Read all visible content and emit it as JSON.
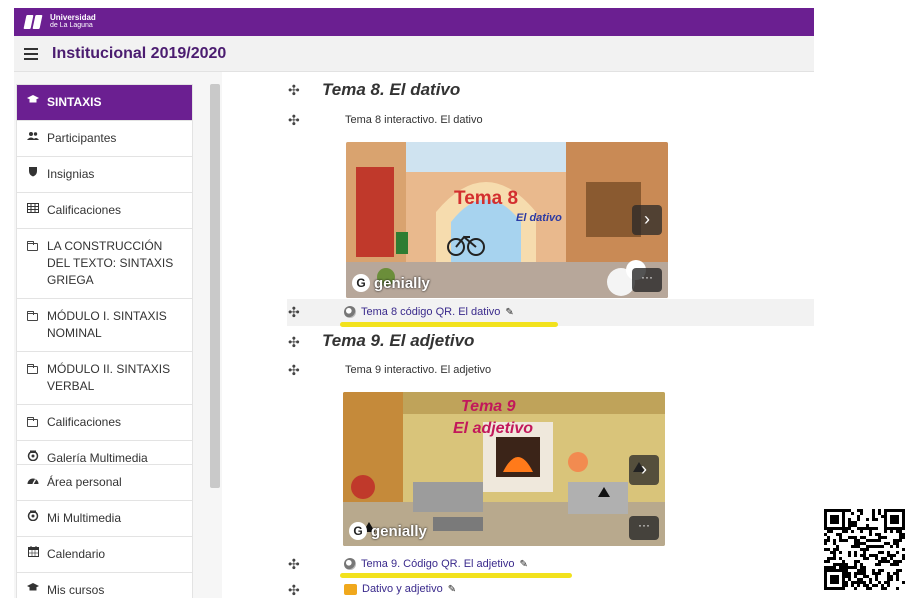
{
  "brand": {
    "line1": "Universidad",
    "line2": "de La Laguna"
  },
  "course": {
    "title": "Institucional 2019/2020"
  },
  "sidebar": {
    "course_items": [
      {
        "label": "SINTAXIS",
        "icon": "graduation-cap-icon",
        "active": true
      },
      {
        "label": "Participantes",
        "icon": "users-icon"
      },
      {
        "label": "Insignias",
        "icon": "shield-icon"
      },
      {
        "label": "Calificaciones",
        "icon": "table-icon"
      },
      {
        "label": "LA CONSTRUCCIÓN DEL TEXTO: SINTAXIS GRIEGA",
        "icon": "folder-icon"
      },
      {
        "label": "MÓDULO I. SINTAXIS NOMINAL",
        "icon": "folder-icon"
      },
      {
        "label": "MÓDULO II. SINTAXIS VERBAL",
        "icon": "folder-icon"
      },
      {
        "label": "Calificaciones",
        "icon": "folder-icon"
      },
      {
        "label": "Galería Multimedia",
        "icon": "media-icon"
      }
    ],
    "site_items": [
      {
        "label": "Área personal",
        "icon": "dashboard-icon"
      },
      {
        "label": "Mi Multimedia",
        "icon": "media-icon"
      },
      {
        "label": "Calendario",
        "icon": "calendar-icon"
      },
      {
        "label": "Mis cursos",
        "icon": "graduation-cap-icon"
      }
    ]
  },
  "content": {
    "section8": {
      "title": "Tema 8. El dativo",
      "activity": "Tema 8 interactivo. El dativo",
      "card_title": "Tema 8",
      "card_subtitle": "El dativo",
      "card_brand": "genially",
      "qr_link": "Tema 8 código QR. El dativo"
    },
    "section9": {
      "title": "Tema 9. El adjetivo",
      "activity": "Tema 9 interactivo. El adjetivo",
      "card_title": "Tema 9",
      "card_subtitle": "El adjetivo",
      "card_brand": "genially",
      "qr_link": "Tema 9. Código QR. El adjetivo"
    },
    "extra_link": "Dativo y adjetivo"
  },
  "colors": {
    "brand": "#6b1f91",
    "highlight": "#f2e21d",
    "link": "#3a2a8c"
  }
}
